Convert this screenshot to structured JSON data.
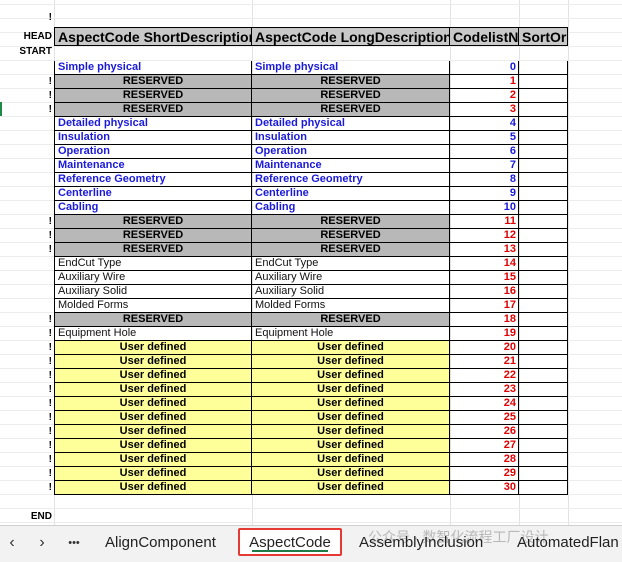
{
  "markers": {
    "bang": "!",
    "head": "HEAD",
    "start": "START",
    "end": "END"
  },
  "headers": [
    "AspectCode ShortDescription",
    "AspectCode LongDescription",
    "CodelistNumber",
    "SortOrder"
  ],
  "rows": [
    {
      "mark": "",
      "type": "blue",
      "short": "Simple physical",
      "long": "Simple physical",
      "code": "0"
    },
    {
      "mark": "!",
      "type": "reserved",
      "short": "RESERVED",
      "long": "RESERVED",
      "code": "1"
    },
    {
      "mark": "!",
      "type": "reserved",
      "short": "RESERVED",
      "long": "RESERVED",
      "code": "2"
    },
    {
      "mark": "!",
      "type": "reserved",
      "short": "RESERVED",
      "long": "RESERVED",
      "code": "3"
    },
    {
      "mark": "",
      "type": "blue",
      "short": "Detailed physical",
      "long": "Detailed physical",
      "code": "4"
    },
    {
      "mark": "",
      "type": "blue",
      "short": "Insulation",
      "long": "Insulation",
      "code": "5"
    },
    {
      "mark": "",
      "type": "blue",
      "short": "Operation",
      "long": "Operation",
      "code": "6"
    },
    {
      "mark": "",
      "type": "blue",
      "short": "Maintenance",
      "long": "Maintenance",
      "code": "7"
    },
    {
      "mark": "",
      "type": "blue",
      "short": "Reference Geometry",
      "long": "Reference Geometry",
      "code": "8"
    },
    {
      "mark": "",
      "type": "blue",
      "short": "Centerline",
      "long": "Centerline",
      "code": "9"
    },
    {
      "mark": "",
      "type": "blue",
      "short": "Cabling",
      "long": "Cabling",
      "code": "10"
    },
    {
      "mark": "!",
      "type": "reserved",
      "short": "RESERVED",
      "long": "RESERVED",
      "code": "11"
    },
    {
      "mark": "!",
      "type": "reserved",
      "short": "RESERVED",
      "long": "RESERVED",
      "code": "12"
    },
    {
      "mark": "!",
      "type": "reserved",
      "short": "RESERVED",
      "long": "RESERVED",
      "code": "13"
    },
    {
      "mark": "",
      "type": "plain",
      "short": "EndCut Type",
      "long": "EndCut Type",
      "code": "14"
    },
    {
      "mark": "",
      "type": "plain",
      "short": "Auxiliary Wire",
      "long": "Auxiliary Wire",
      "code": "15"
    },
    {
      "mark": "",
      "type": "plain",
      "short": "Auxiliary Solid",
      "long": "Auxiliary Solid",
      "code": "16"
    },
    {
      "mark": "",
      "type": "plain",
      "short": "Molded Forms",
      "long": "Molded Forms",
      "code": "17"
    },
    {
      "mark": "!",
      "type": "reserved",
      "short": "RESERVED",
      "long": "RESERVED",
      "code": "18"
    },
    {
      "mark": "!",
      "type": "plain",
      "short": "Equipment Hole",
      "long": "Equipment Hole",
      "code": "19"
    },
    {
      "mark": "!",
      "type": "user",
      "short": "User defined",
      "long": "User defined",
      "code": "20"
    },
    {
      "mark": "!",
      "type": "user",
      "short": "User defined",
      "long": "User defined",
      "code": "21"
    },
    {
      "mark": "!",
      "type": "user",
      "short": "User defined",
      "long": "User defined",
      "code": "22"
    },
    {
      "mark": "!",
      "type": "user",
      "short": "User defined",
      "long": "User defined",
      "code": "23"
    },
    {
      "mark": "!",
      "type": "user",
      "short": "User defined",
      "long": "User defined",
      "code": "24"
    },
    {
      "mark": "!",
      "type": "user",
      "short": "User defined",
      "long": "User defined",
      "code": "25"
    },
    {
      "mark": "!",
      "type": "user",
      "short": "User defined",
      "long": "User defined",
      "code": "26"
    },
    {
      "mark": "!",
      "type": "user",
      "short": "User defined",
      "long": "User defined",
      "code": "27"
    },
    {
      "mark": "!",
      "type": "user",
      "short": "User defined",
      "long": "User defined",
      "code": "28"
    },
    {
      "mark": "!",
      "type": "user",
      "short": "User defined",
      "long": "User defined",
      "code": "29"
    },
    {
      "mark": "!",
      "type": "user",
      "short": "User defined",
      "long": "User defined",
      "code": "30"
    }
  ],
  "tabs": {
    "prev": "‹",
    "next": "›",
    "more": "•••",
    "items": [
      "AlignComponent",
      "AspectCode",
      "AssemblyInclusion",
      "AutomatedFlan"
    ],
    "active": "AspectCode",
    "watermark": "公众号 · 数智化流程工厂设计"
  },
  "icons": [
    "chevron-left-icon",
    "chevron-right-icon",
    "more-icon"
  ],
  "colors": {
    "blue_text": "#1a1adb",
    "red_code": "#e00000",
    "reserved_fill": "#b8b8b8",
    "user_fill": "#ffff99",
    "header_fill": "#c8c8c8",
    "active_tab_outline": "#e53935"
  }
}
